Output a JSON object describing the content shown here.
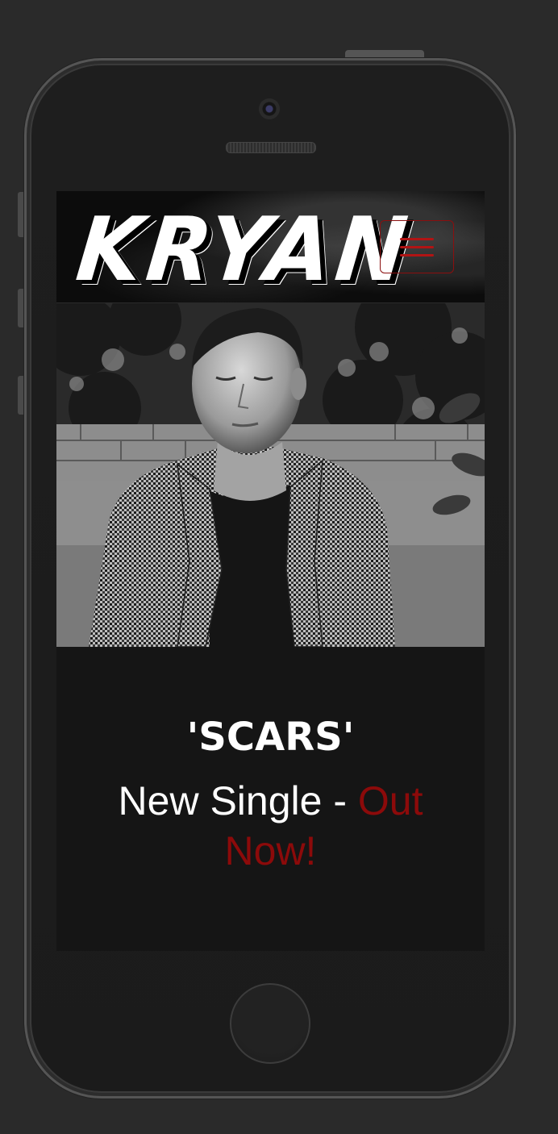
{
  "header": {
    "logo_text": "KRYAN",
    "menu_icon": "hamburger-icon"
  },
  "hero": {
    "image": "black-and-white portrait photo"
  },
  "release": {
    "title": "'SCARS'",
    "subtitle_prefix": "New Single - ",
    "subtitle_accent": "Out Now!"
  },
  "colors": {
    "accent": "#8c0a0a",
    "background": "#151515",
    "text": "#ffffff",
    "page_background": "#2a2a2a"
  }
}
